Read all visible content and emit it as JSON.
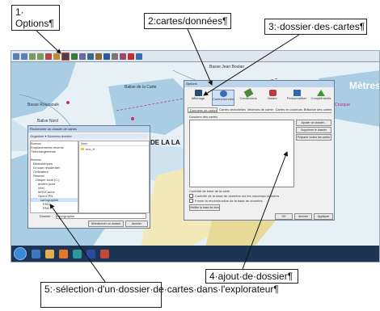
{
  "callouts": {
    "options": "1· Options¶",
    "cartes": "2:cartes/données¶",
    "dossier": "3:·dossier·des·cartes¶",
    "ajout": "4·ajout·de·dossier¶",
    "selection": "5:·sélection·d'un·dossier·de·cartes·dans·l'explorateur¶"
  },
  "map": {
    "place_pointe": "POINTE DE LA LA",
    "place_metres": "Mètres",
    "place_cartes": "Balise de la Carte",
    "place_nord": "Balise Nord",
    "place_raz": "Basse Rouzaouik",
    "place_jean": "Basse Jean Boulan",
    "place_crusque": "Crusque"
  },
  "options_dialog": {
    "title": "Options",
    "tabs": [
      "Affichage",
      "Cartes/données",
      "Connexions",
      "Navire",
      "Personnaliser",
      "Compléments"
    ],
    "subtabs": [
      "Données de cartes",
      "Cartes vectorielles",
      "Vecteurs de cartes",
      "Cartes en couleurs",
      "Brillance des cartes"
    ],
    "list_header": "Dossiers des cartes",
    "add_button": "Ajouter un dossier...",
    "remove_button": "Supprimer le dossier",
    "prepare_button": "Préparer toutes les cartes",
    "options_label": "Contrôle de base de la carte",
    "checkbox1": "Contrôle de la base de données sur les nouveaux dossiers",
    "checkbox2": "Forcer la reconstruction de la base de données",
    "rebuild_button": "Vérifier la base de données",
    "ok": "OK",
    "cancel": "Annuler",
    "apply": "Appliquer"
  },
  "explorer_dialog": {
    "title": "Rechercher un dossier de cartes",
    "breadcrumb": "Organiser ▾   Nouveau dossier",
    "tree": [
      "Bureau",
      "Emplacements récents",
      "Téléchargements",
      "",
      "Bureau",
      "Bibliothèques",
      "Groupe résidentiel",
      "Ordinateur",
      "Réseau",
      "Disque local (C:)",
      "ancien puss",
      "Intel",
      "MSOCache",
      "OpenCPN",
      "cartographie",
      "ENC",
      "RNC"
    ],
    "right_header": "Nom",
    "right_items": [
      "enc_fr"
    ],
    "folder_label": "Dossier :",
    "folder_value": "cartographie",
    "select_button": "Sélectionner un dossier",
    "cancel_button": "Annuler"
  },
  "colors": {
    "land": "#f3e8b8",
    "shallow": "#a9cde2",
    "sea": "#e7f1f5",
    "magenta": "#c4297a"
  }
}
